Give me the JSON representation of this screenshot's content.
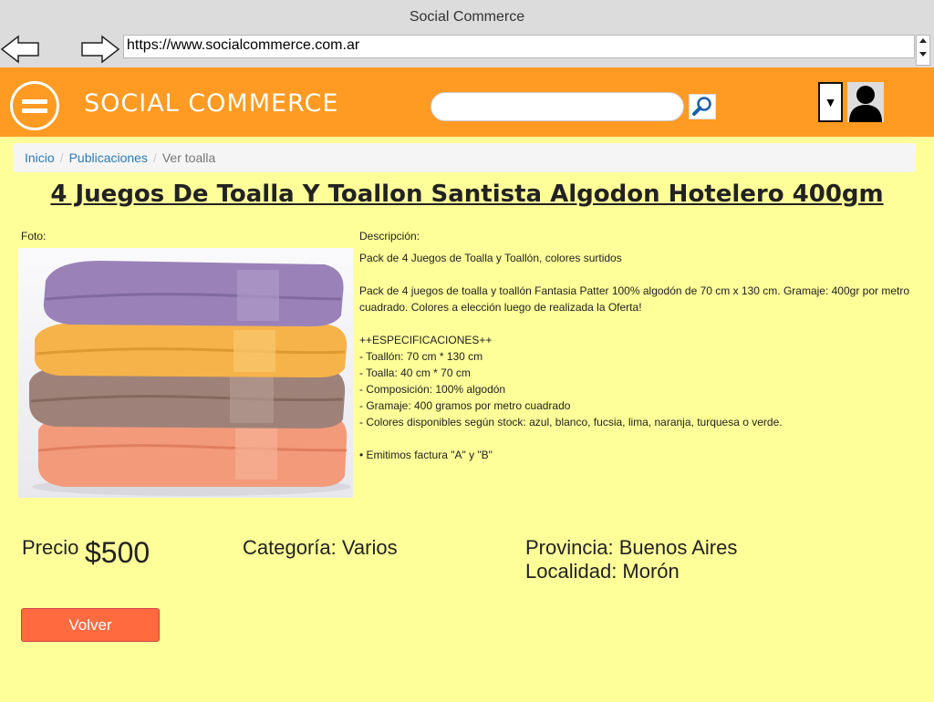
{
  "browser": {
    "window_title": "Social Commerce",
    "url": "https://www.socialcommerce.com.ar"
  },
  "header": {
    "brand": "SOCIAL COMMERCE",
    "search_placeholder": "",
    "dropdown_glyph": "▼",
    "menu_icon": "hamburger-circle-icon",
    "search_icon": "magnifier-icon",
    "avatar_icon": "user-silhouette-icon"
  },
  "breadcrumb": {
    "items": [
      "Inicio",
      "Publicaciones",
      "Ver toalla"
    ],
    "separator": "/"
  },
  "product": {
    "title": "4 Juegos De Toalla Y Toallon Santista Algodon Hotelero 400gm",
    "photo_label": "Foto:",
    "description_label": "Descripción:",
    "description": {
      "summary": "Pack de 4 Juegos de Toalla y Toallón, colores surtidos",
      "detail": "Pack de 4 juegos de toalla y toallón Fantasia Patter 100% algodón de 70 cm x 130 cm. Gramaje: 400gr por metro cuadrado. Colores a elección luego de realizada la Oferta!",
      "specs_header": "++ESPECIFICACIONES++",
      "specs": [
        "- Toallón: 70 cm * 130 cm",
        "- Toalla: 40 cm * 70 cm",
        "- Composición: 100% algodón",
        "- Gramaje: 400 gramos por metro cuadrado",
        "- Colores disponibles según stock: azul, blanco, fucsia, lima, naranja, turquesa o verde."
      ],
      "invoice_note": "• Emitimos factura \"A\" y \"B\""
    },
    "price_label": "Precio",
    "price": "$500",
    "category": "Categoría: Varios",
    "province": "Provincia: Buenos Aires",
    "locality": "Localidad: Morón",
    "back_label": "Volver"
  },
  "colors": {
    "header_orange": "#ff9a22",
    "page_yellow": "#ffff99",
    "button_red": "#ff6a3f",
    "link_blue": "#2a7ab8"
  }
}
